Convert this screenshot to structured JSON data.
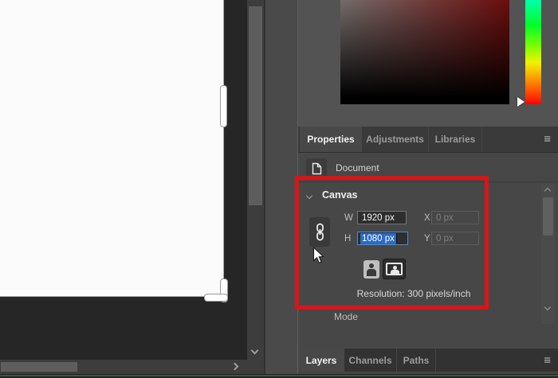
{
  "colors": {
    "annotation_red": "#dc1417",
    "selection_blue": "#2a6bc4",
    "focus_border_blue": "#4d8ad1",
    "panel_background": "#474747"
  },
  "properties_panel": {
    "tabs": [
      "Properties",
      "Adjustments",
      "Libraries"
    ],
    "active_tab": "Properties",
    "menu_icon": "≡",
    "document_label": "Document"
  },
  "canvas_section": {
    "title": "Canvas",
    "w_label": "W",
    "w_value": "1920 px",
    "x_label": "X",
    "x_value": "0 px",
    "h_label": "H",
    "h_value": "1080 px",
    "y_label": "Y",
    "y_value": "0 px",
    "resolution_text": "Resolution: 300 pixels/inch",
    "mode_label": "Mode"
  },
  "bottom_panel": {
    "tabs": [
      "Layers",
      "Channels",
      "Paths"
    ],
    "active_tab": "Layers",
    "menu_icon": "≡"
  }
}
